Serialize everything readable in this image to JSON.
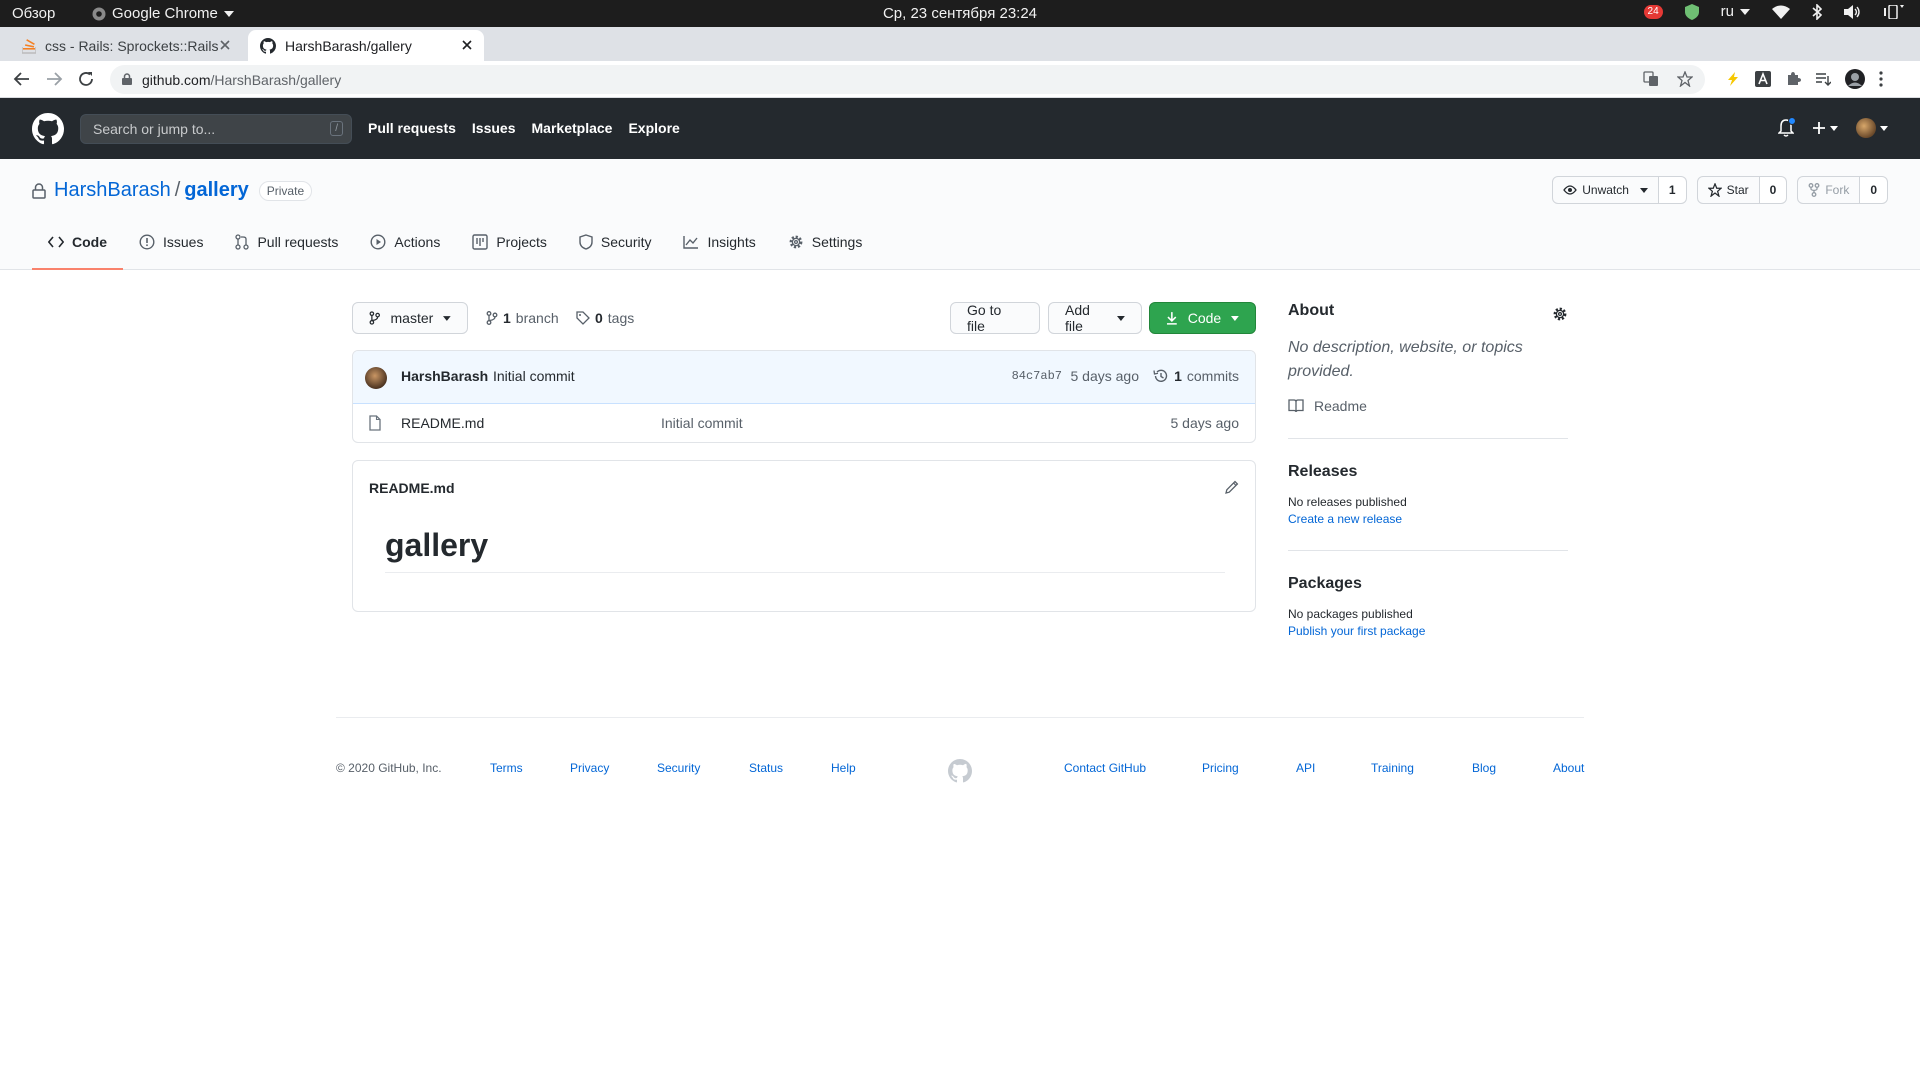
{
  "os": {
    "overview": "Обзор",
    "app_name": "Google Chrome",
    "clock": "Ср, 23 сентября  23:24",
    "notification_count": "24",
    "language": "ru"
  },
  "browser": {
    "tabs": [
      {
        "title": "css - Rails: Sprockets::Rails"
      },
      {
        "title": "HarshBarash/gallery"
      }
    ],
    "url_host": "github.com",
    "url_path": "/HarshBarash/gallery"
  },
  "gh_header": {
    "search_placeholder": "Search or jump to...",
    "search_shortcut": "/",
    "nav": [
      "Pull requests",
      "Issues",
      "Marketplace",
      "Explore"
    ]
  },
  "repo": {
    "owner": "HarshBarash",
    "separator": "/",
    "name": "gallery",
    "visibility": "Private",
    "watch_label": "Unwatch",
    "watch_count": "1",
    "star_label": "Star",
    "star_count": "0",
    "fork_label": "Fork",
    "fork_count": "0",
    "tabs": [
      "Code",
      "Issues",
      "Pull requests",
      "Actions",
      "Projects",
      "Security",
      "Insights",
      "Settings"
    ]
  },
  "toolbar": {
    "branch": "master",
    "branch_count": "1",
    "branch_label": "branch",
    "tag_count": "0",
    "tag_label": "tags",
    "go_to_file": "Go to file",
    "add_file": "Add file",
    "code": "Code"
  },
  "commit": {
    "author": "HarshBarash",
    "message": "Initial commit",
    "sha": "84c7ab7",
    "age": "5 days ago",
    "count": "1",
    "count_label": "commits"
  },
  "files": [
    {
      "name": "README.md",
      "message": "Initial commit",
      "age": "5 days ago"
    }
  ],
  "readme": {
    "title": "README.md",
    "heading": "gallery"
  },
  "sidebar": {
    "about_title": "About",
    "about_desc": "No description, website, or topics provided.",
    "readme_label": "Readme",
    "releases_title": "Releases",
    "releases_empty": "No releases published",
    "releases_link": "Create a new release",
    "packages_title": "Packages",
    "packages_empty": "No packages published",
    "packages_link": "Publish your first package"
  },
  "footer": {
    "copyright": "© 2020 GitHub, Inc.",
    "left_links": [
      "Terms",
      "Privacy",
      "Security",
      "Status",
      "Help"
    ],
    "right_links": [
      "Contact GitHub",
      "Pricing",
      "API",
      "Training",
      "Blog",
      "About"
    ]
  },
  "colors": {
    "header_bg": "#24292e",
    "accent_link": "#0366d6",
    "code_button": "#2ea44f",
    "active_tab_border": "#f9826c"
  }
}
